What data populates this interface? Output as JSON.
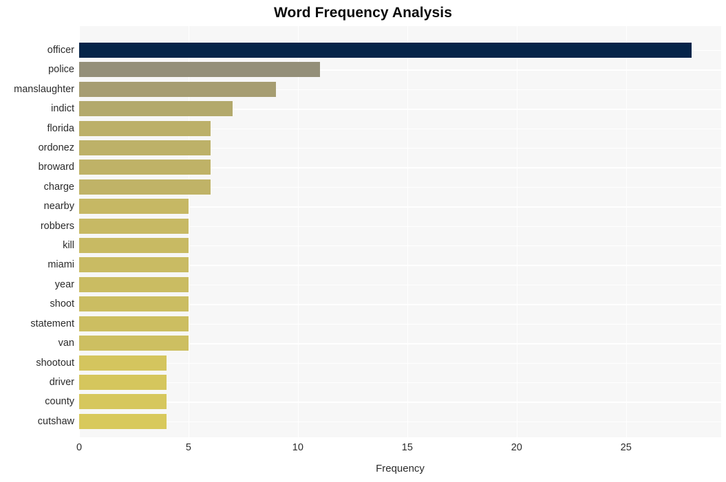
{
  "chart_data": {
    "type": "bar",
    "orientation": "horizontal",
    "title": "Word Frequency Analysis",
    "xlabel": "Frequency",
    "ylabel": "",
    "xlim": [
      0,
      29.35
    ],
    "xticks": [
      0,
      5,
      10,
      15,
      20,
      25
    ],
    "xtick_labels": [
      "0",
      "5",
      "10",
      "15",
      "20",
      "25"
    ],
    "grid": true,
    "legend": null,
    "categories": [
      "officer",
      "police",
      "manslaughter",
      "indict",
      "florida",
      "ordonez",
      "broward",
      "charge",
      "nearby",
      "robbers",
      "kill",
      "miami",
      "year",
      "shoot",
      "statement",
      "van",
      "shootout",
      "driver",
      "county",
      "cutshaw"
    ],
    "values": [
      28,
      11,
      9,
      7,
      6,
      6,
      6,
      6,
      5,
      5,
      5,
      5,
      5,
      5,
      5,
      5,
      4,
      4,
      4,
      4
    ],
    "bar_colors": [
      "#052449",
      "#948f79",
      "#a69d72",
      "#b3a96c",
      "#bcb069",
      "#bdb168",
      "#bfb267",
      "#c0b367",
      "#c6b864",
      "#c7b964",
      "#c8ba63",
      "#c9bb63",
      "#cabc62",
      "#cbbd62",
      "#ccbe61",
      "#cdbf61",
      "#d4c55e",
      "#d5c65d",
      "#d6c75d",
      "#d8c95c"
    ],
    "plot_background": "#f7f7f7",
    "gridline_color": "#ffffff",
    "page_background": "#ffffff",
    "text_color": "#2b2b2b",
    "title_color": "#0b0b0b"
  }
}
